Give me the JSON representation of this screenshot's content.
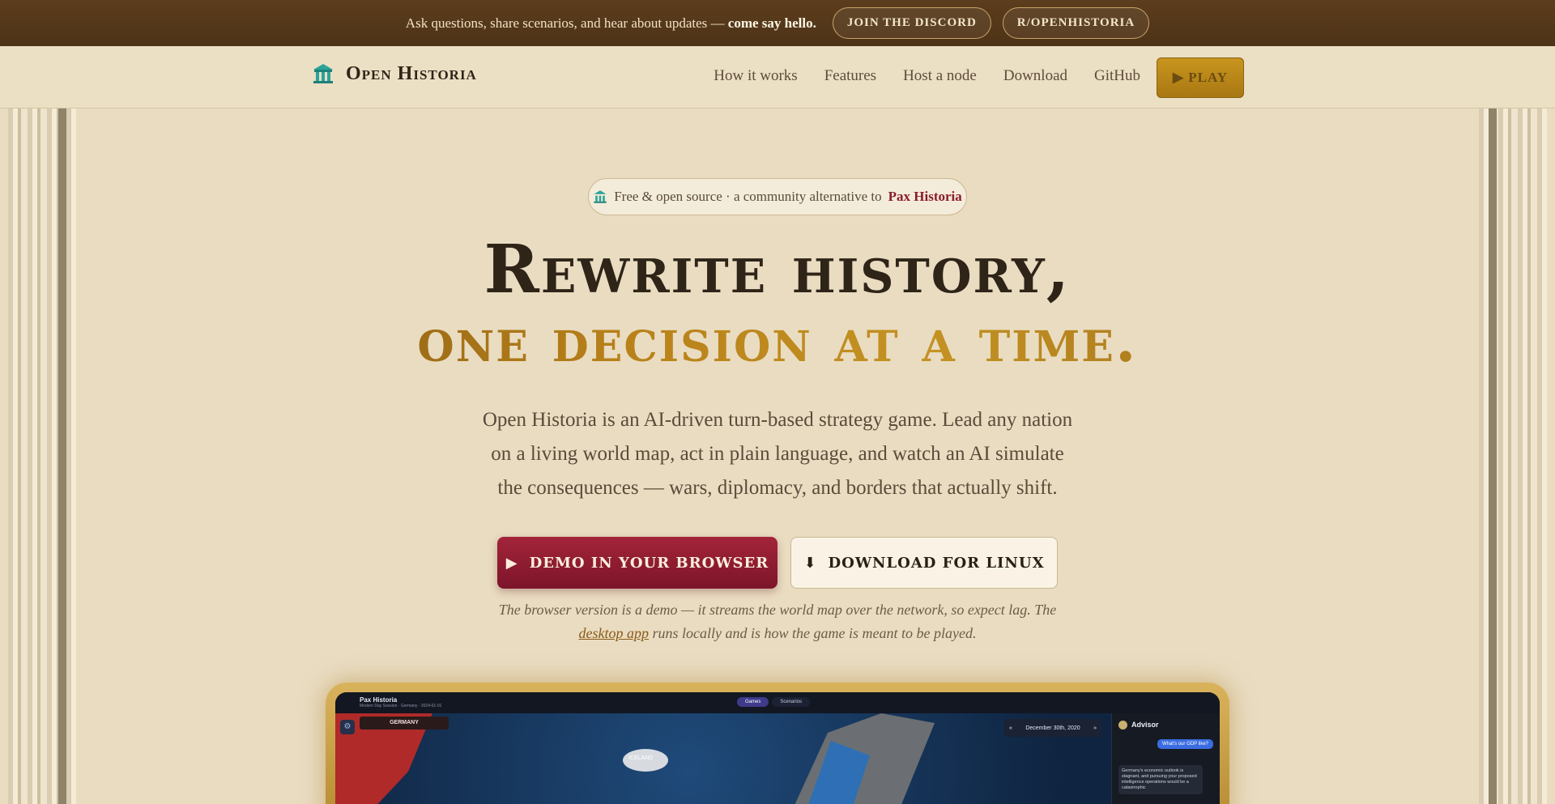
{
  "announcement": {
    "message": "Ask questions, share scenarios, and hear about updates —",
    "message_bold": "come say hello.",
    "discord_label": "JOIN THE DISCORD",
    "reddit_label": "R/OPENHISTORIA"
  },
  "nav": {
    "brand": "Open Historia",
    "links": [
      "How it works",
      "Features",
      "Host a node",
      "Download",
      "GitHub"
    ],
    "play_label": "▶ PLAY"
  },
  "hero": {
    "badge_text": "Free & open source · a community alternative to",
    "badge_link": "Pax Historia",
    "title_line1": "Rewrite history,",
    "title_line2": "one decision at a time.",
    "lede": "Open Historia is an AI-driven turn-based strategy game. Lead any nation on a living world map, act in plain language, and watch an AI simulate the consequences — wars, diplomacy, and borders that actually shift.",
    "demo_button": "DEMO IN YOUR BROWSER",
    "linux_button": "DOWNLOAD FOR LINUX",
    "note_before": "The browser version is a demo — it streams the world map over the network, so expect lag. The",
    "note_link": "desktop app",
    "note_after": "runs locally and is how the game is meant to be played."
  },
  "preview": {
    "app_title": "Pax Historia",
    "app_subtitle": "Modern Day Session · Germany · 2024-01-01",
    "tabs": [
      "Games",
      "Scenarios"
    ],
    "country_tag": "GERMANY",
    "map_label": "ICELAND",
    "date": "December 30th, 2020",
    "advisor_title": "Advisor",
    "advisor_question": "What's our GDP like?",
    "advisor_answer": "Germany's economic outlook is stagnant, and pursuing your proposed intelligence operations would be a catastrophic"
  },
  "colors": {
    "topbar": "#5c3d1d",
    "accent_crimson": "#8a1d2c",
    "accent_gold": "#b88119",
    "parchment": "#e9dcc1"
  },
  "icons": {
    "brand": "temple-icon",
    "badge": "temple-icon",
    "demo": "play-icon",
    "linux": "download-icon"
  }
}
